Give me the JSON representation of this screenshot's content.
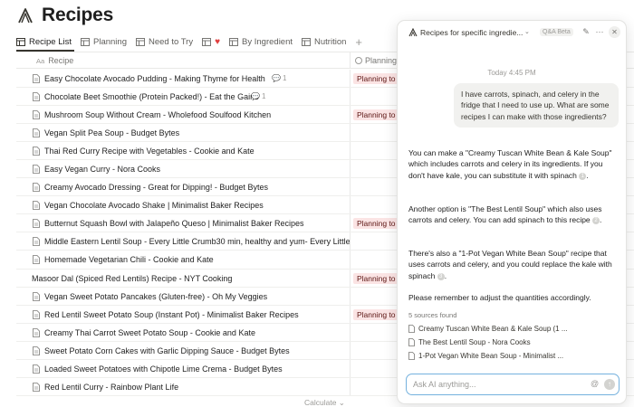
{
  "page": {
    "title": "Recipes"
  },
  "tabs": [
    {
      "label": "Recipe List"
    },
    {
      "label": "Planning"
    },
    {
      "label": "Need to Try"
    },
    {
      "label": ""
    },
    {
      "label": "By Ingredient"
    },
    {
      "label": "Nutrition"
    }
  ],
  "table": {
    "col_name": "Recipe",
    "col_name_icon": "Aa",
    "col_planning": "Planning",
    "rows": [
      {
        "name": "Easy Chocolate Avocado Pudding - Making Thyme for Health",
        "comments": "1",
        "tag": "Planning to"
      },
      {
        "name": "Chocolate Beet Smoothie (Protein Packed!) - Eat the Gains",
        "comments": "1",
        "tag": ""
      },
      {
        "name": "Mushroom Soup Without Cream - Wholefood Soulfood Kitchen",
        "comments": "",
        "tag": "Planning to"
      },
      {
        "name": "Vegan Split Pea Soup - Budget Bytes",
        "comments": "",
        "tag": ""
      },
      {
        "name": "Thai Red Curry Recipe with Vegetables - Cookie and Kate",
        "comments": "",
        "tag": ""
      },
      {
        "name": "Easy Vegan Curry - Nora Cooks",
        "comments": "",
        "tag": ""
      },
      {
        "name": "Creamy Avocado Dressing - Great for Dipping! - Budget Bytes",
        "comments": "",
        "tag": ""
      },
      {
        "name": "Vegan Chocolate Avocado Shake | Minimalist Baker Recipes",
        "comments": "",
        "tag": ""
      },
      {
        "name": "Butternut Squash Bowl with Jalapeño Queso | Minimalist Baker Recipes",
        "comments": "",
        "tag": "Planning to"
      },
      {
        "name": "Middle Eastern Lentil Soup - Every Little Crumb30 min, healthy and yum- Every Little",
        "comments": "",
        "tag": ""
      },
      {
        "name": "Homemade Vegetarian Chili - Cookie and Kate",
        "comments": "",
        "tag": ""
      },
      {
        "name": "Masoor Dal (Spiced Red Lentils) Recipe - NYT Cooking",
        "comments": "",
        "tag": "Planning to",
        "noicon": true
      },
      {
        "name": "Vegan Sweet Potato Pancakes (Gluten-free) - Oh My Veggies",
        "comments": "",
        "tag": ""
      },
      {
        "name": "Red Lentil Sweet Potato Soup (Instant Pot) - Minimalist Baker Recipes",
        "comments": "",
        "tag": "Planning to"
      },
      {
        "name": "Creamy Thai Carrot Sweet Potato Soup - Cookie and Kate",
        "comments": "",
        "tag": ""
      },
      {
        "name": "Sweet Potato Corn Cakes with Garlic Dipping Sauce - Budget Bytes",
        "comments": "",
        "tag": ""
      },
      {
        "name": "Loaded Sweet Potatoes with Chipotle Lime Crema - Budget Bytes",
        "comments": "",
        "tag": ""
      },
      {
        "name": "Red Lentil Curry - Rainbow Plant Life",
        "comments": "",
        "tag": ""
      }
    ],
    "calculate_label": "Calculate"
  },
  "ai_panel": {
    "title": "Recipes for specific ingredie...",
    "badge": "Q&A Beta",
    "timestamp": "Today 4:45 PM",
    "user_message": "I have carrots, spinach, and celery in the fridge that I need to use up. What are some recipes I can make with those ingredients?",
    "answer": [
      {
        "text": "You can make a \"Creamy Tuscan White Bean & Kale Soup\" which includes carrots and celery in its ingredients. If you don't have kale, you can substitute it with spinach",
        "cite": "1"
      },
      {
        "text": "Another option is \"The Best Lentil Soup\" which also uses carrots and celery. You can add spinach to this recipe",
        "cite": "2"
      },
      {
        "text": "There's also a \"1-Pot Vegan White Bean Soup\" recipe that uses carrots and celery, and you could replace the kale with spinach",
        "cite": "3"
      },
      {
        "text": "Please remember to adjust the quantities accordingly.",
        "cite": ""
      }
    ],
    "sources_label": "5 sources found",
    "sources": [
      "Creamy Tuscan White Bean & Kale Soup (1 ...",
      "The Best Lentil Soup - Nora Cooks",
      "1-Pot Vegan White Bean Soup - Minimalist ..."
    ],
    "input_placeholder": "Ask AI anything..."
  },
  "colors": {
    "accent": "#74b1de",
    "tag_bg": "#fbe4e4",
    "heart": "#e03e3e"
  }
}
